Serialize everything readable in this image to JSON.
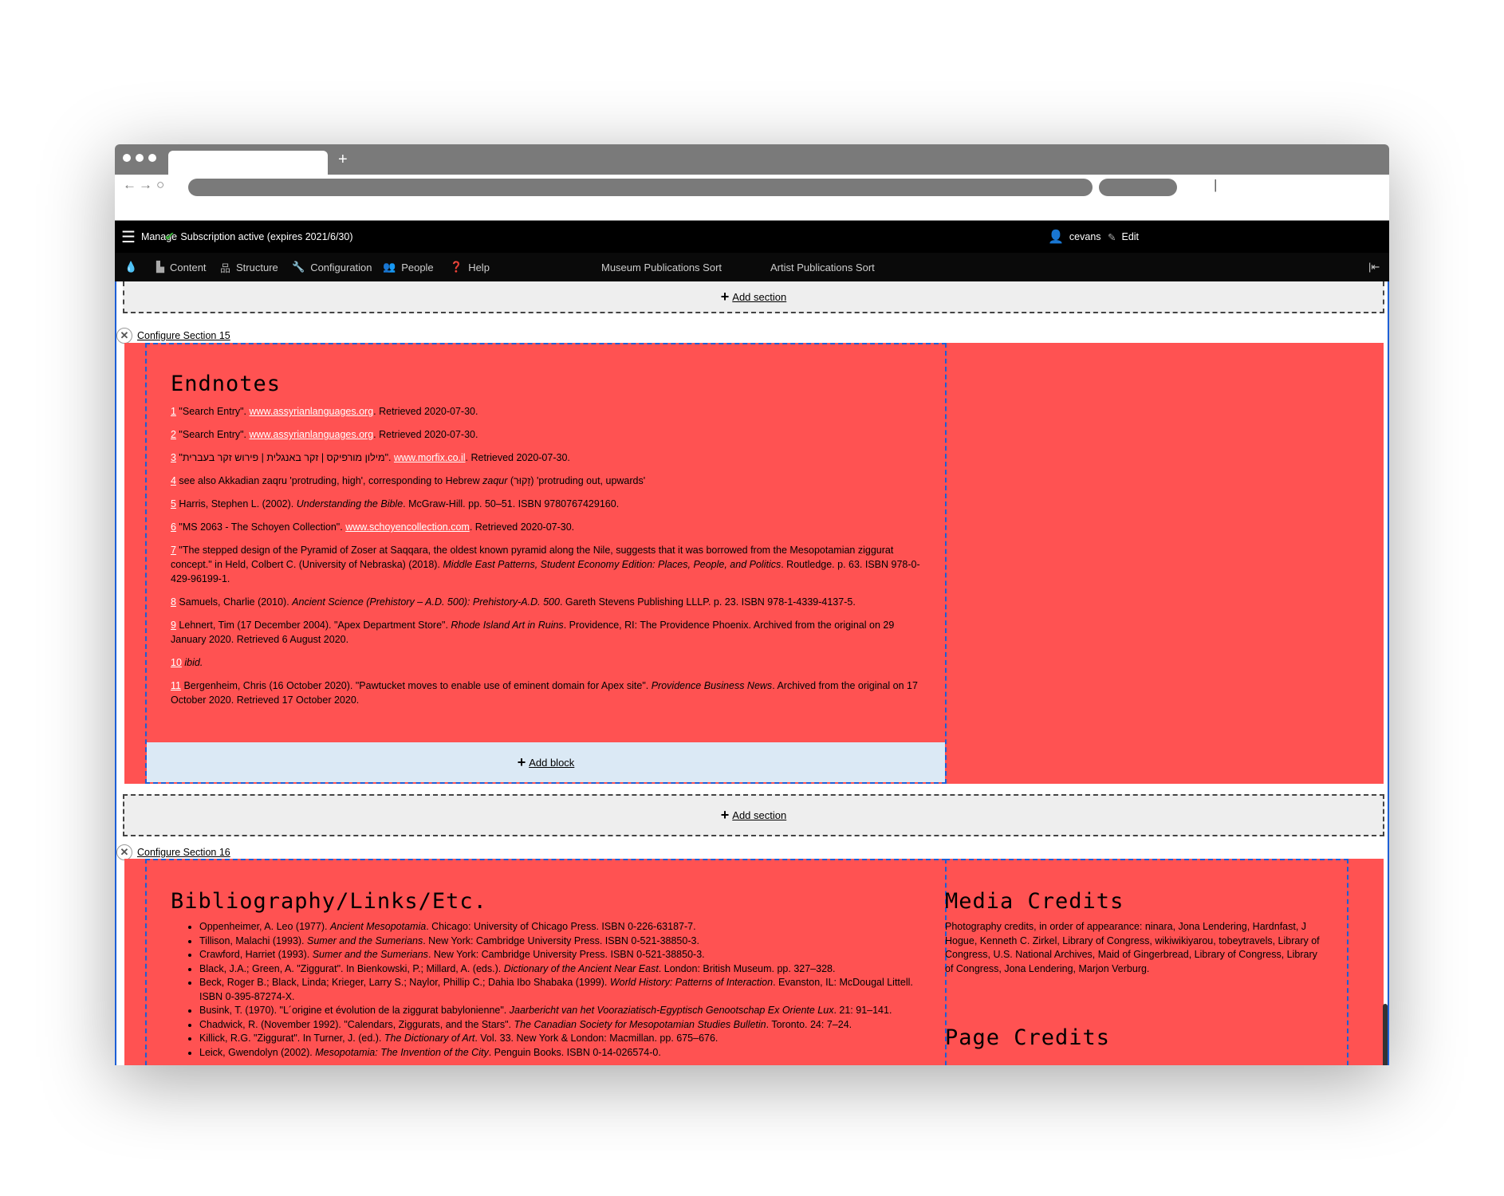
{
  "browser": {
    "new_tab": "+"
  },
  "toolbar": {
    "manage": "Manage",
    "subscription": "Subscription active (expires 2021/6/30)",
    "user": "cevans",
    "edit": "Edit",
    "items": [
      {
        "label": "Content",
        "icon": "file-icon"
      },
      {
        "label": "Structure",
        "icon": "sitemap-icon"
      },
      {
        "label": "Configuration",
        "icon": "wrench-icon"
      },
      {
        "label": "People",
        "icon": "people-icon"
      },
      {
        "label": "Help",
        "icon": "help-icon"
      }
    ],
    "shortcuts": [
      "Museum Publications Sort",
      "Artist Publications Sort"
    ]
  },
  "layout": {
    "add_section": "Add section",
    "add_block": "Add block",
    "configure_15": "Configure Section 15",
    "configure_16": "Configure Section 16"
  },
  "endnotes": {
    "title": "Endnotes",
    "items": [
      {
        "n": "1",
        "html": "\"Search Entry\". <a>www.assyrianlanguages.org</a>. Retrieved 2020-07-30."
      },
      {
        "n": "2",
        "html": "\"Search Entry\". <a>www.assyrianlanguages.org</a>. Retrieved 2020-07-30."
      },
      {
        "n": "3",
        "html": "\"<span dir='rtl'>מילון מורפיקס | זקר באנגלית | פירוש זקר בעברית</span>\". <a>www.morfix.co.il</a>. Retrieved 2020-07-30."
      },
      {
        "n": "4",
        "html": "see also Akkadian zaqru 'protruding, high', corresponding to Hebrew <i>zaqur</i> (זָקוּר) 'protruding out, upwards'"
      },
      {
        "n": "5",
        "html": "Harris, Stephen L. (2002). <i>Understanding the Bible</i>. McGraw-Hill. pp. 50–51. ISBN 9780767429160."
      },
      {
        "n": "6",
        "html": "\"MS 2063 - The Schoyen Collection\". <a>www.schoyencollection.com</a>. Retrieved 2020-07-30."
      },
      {
        "n": "7",
        "html": "\"The stepped design of the Pyramid of Zoser at Saqqara, the oldest known pyramid along the Nile, suggests that it was borrowed from the Mesopotamian ziggurat concept.\" in Held, Colbert C. (University of Nebraska) (2018). <i>Middle East Patterns, Student Economy Edition: Places, People, and Politics</i>. Routledge. p. 63. ISBN 978-0-429-96199-1."
      },
      {
        "n": "8",
        "html": "Samuels, Charlie (2010). <i>Ancient Science (Prehistory – A.D. 500): Prehistory-A.D. 500</i>. Gareth Stevens Publishing LLLP. p. 23. ISBN 978-1-4339-4137-5."
      },
      {
        "n": "9",
        "html": " Lehnert, Tim (17 December 2004). \"Apex Department Store\". <i>Rhode Island Art in Ruins</i>. Providence, RI: The Providence Phoenix. Archived from the original on 29 January 2020. Retrieved 6 August 2020."
      },
      {
        "n": "10",
        "html": "<i>ibid.</i>"
      },
      {
        "n": "11",
        "html": "Bergenheim, Chris (16 October 2020). \"Pawtucket moves to enable use of eminent domain for Apex site\". <i>Providence Business News</i>. Archived from the original on 17 October 2020. Retrieved 17 October 2020."
      }
    ]
  },
  "bibliography": {
    "title": "Bibliography/Links/Etc.",
    "items": [
      "Oppenheimer, A. Leo (1977). <i>Ancient Mesopotamia</i>. Chicago: University of Chicago Press. ISBN 0-226-63187-7.",
      "Tillison, Malachi (1993). <i>Sumer and the Sumerians</i>. New York: Cambridge University Press. ISBN 0-521-38850-3.",
      "Crawford, Harriet (1993). <i>Sumer and the Sumerians</i>. New York: Cambridge University Press. ISBN 0-521-38850-3.",
      "Black, J.A.; Green, A. \"Ziggurat\". In Bienkowski, P.; Millard, A. (eds.). <i>Dictionary of the Ancient Near East</i>. London: British Museum. pp. 327–328.",
      "Beck, Roger B.; Black, Linda; Krieger, Larry S.; Naylor, Phillip C.; Dahia Ibo Shabaka (1999). <i>World History: Patterns of Interaction</i>. Evanston, IL: McDougal Littell. ISBN 0-395-87274-X.",
      "Busink, T. (1970). \"L´origine et évolution de la ziggurat babylonienne\". <i>Jaarbericht van het Vooraziatisch-Egyptisch Genootschap Ex Oriente Lux</i>. 21: 91–141.",
      "Chadwick, R. (November 1992). \"Calendars, Ziggurats, and the Stars\". <i>The Canadian Society for Mesopotamian Studies Bulletin</i>. Toronto. 24: 7–24.",
      "Killick, R.G. \"Ziggurat\". In Turner, J. (ed.). <i>The Dictionary of Art</i>. Vol. 33. New York &amp; London: Macmillan. pp. 675–676.",
      "Leick, Gwendolyn (2002). <i>Mesopotamia: The Invention of the City</i>. Penguin Books. ISBN 0-14-026574-0."
    ]
  },
  "media_credits": {
    "title": "Media Credits",
    "text": "Photography credits, in order of appearance: ninara, Jona Lendering, Hardnfast, J Hogue, Kenneth C. Zirkel, Library of Congress, wikiwikiyarou, tobeytravels, Library of Congress, U.S. National Archives, Maid of Gingerbread, Library of Congress, Library of Congress, Jona Lendering, Marjon Verburg."
  },
  "page_credits": {
    "title": "Page Credits"
  },
  "colors": {
    "section_bg": "#ff5252",
    "block_outline": "#1d5fd6",
    "add_block_bg": "#dbe9f5",
    "toolbar": "#000000"
  }
}
